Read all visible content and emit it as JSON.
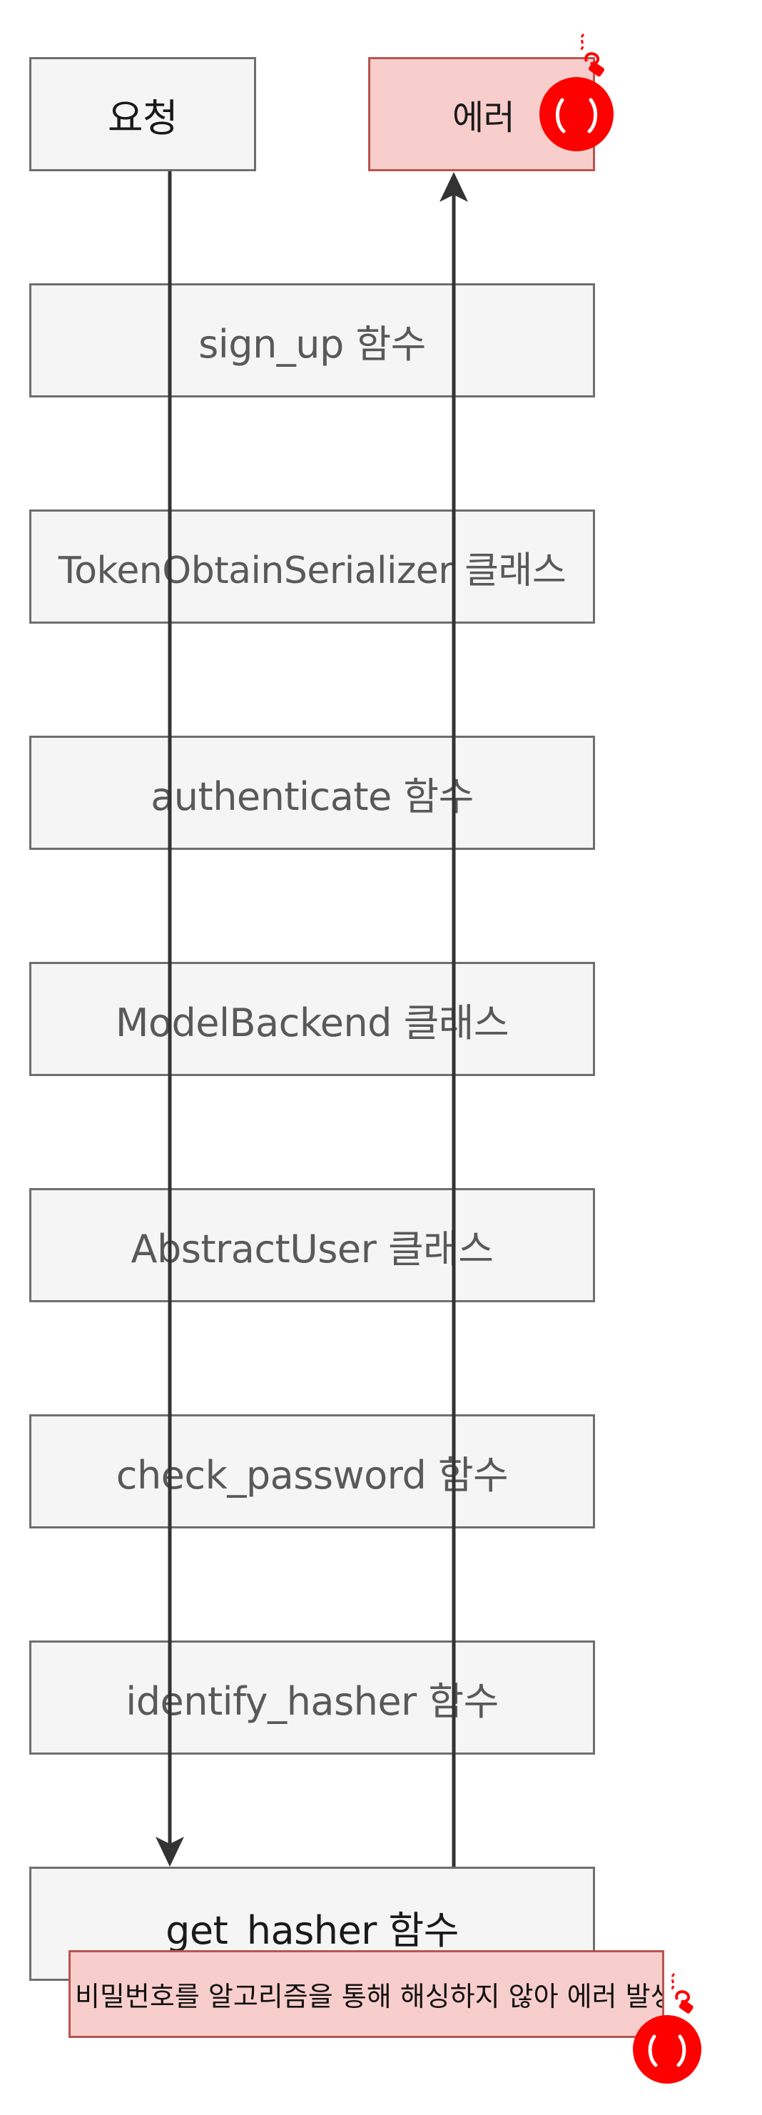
{
  "nodes": {
    "request": "요청",
    "error": "에러",
    "sign_up": "sign_up 함수",
    "token": "TokenObtainSerializer 클래스",
    "authenticate": "authenticate 함수",
    "model_backend": "ModelBackend 클래스",
    "abstract_user": "AbstractUser 클래스",
    "check_password": "check_password 함수",
    "identify_hasher": "identify_hasher 함수",
    "get_hasher": "get_hasher 함수"
  },
  "note": "비밀번호를 알고리즘을 통해 해싱하지 않아 에러 발생",
  "colors": {
    "node_fill": "#f5f5f5",
    "node_border": "#6e6e6e",
    "error_fill": "#f8cecc",
    "error_border": "#b85450",
    "bomb": "#ff0000",
    "arrow": "#333333"
  },
  "icons": {
    "error_icon": "bomb-icon",
    "note_icon": "bomb-icon"
  }
}
